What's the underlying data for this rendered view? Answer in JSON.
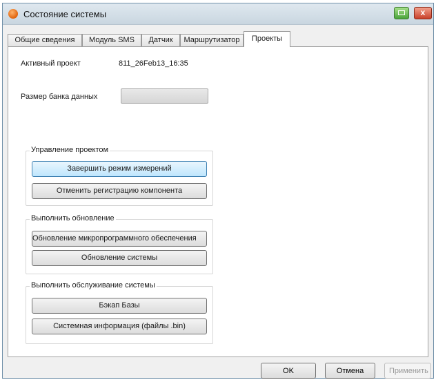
{
  "window": {
    "title": "Состояние системы",
    "app_icon": "testo-logo-icon",
    "controls": {
      "green_icon": "monitor-icon",
      "close_icon": "close-icon",
      "close_glyph": "x"
    }
  },
  "tabs": [
    {
      "label": "Общие сведения",
      "active": false
    },
    {
      "label": "Модуль SMS",
      "active": false
    },
    {
      "label": "Датчик",
      "active": false
    },
    {
      "label": "Маршрутизатор",
      "active": false
    },
    {
      "label": "Проекты",
      "active": true
    }
  ],
  "project": {
    "active_label": "Активный проект",
    "active_value": "811_26Feb13_16:35",
    "db_size_label": "Размер банка данных"
  },
  "groups": {
    "project_management": {
      "title": "Управление проектом",
      "buttons": [
        "Завершить режим измерений",
        "Отменить регистрацию компонента"
      ]
    },
    "update": {
      "title": "Выполнить обновление",
      "buttons": [
        "Обновление микропрограммного обеспечения",
        "Обновление системы"
      ]
    },
    "maintenance": {
      "title": "Выполнить обслуживание системы",
      "buttons": [
        "Бэкап Базы",
        "Системная информация (файлы .bin)"
      ]
    }
  },
  "footer": {
    "ok": "OK",
    "cancel": "Отмена",
    "apply": "Применить"
  },
  "colors": {
    "focused_button": "#bee6fd",
    "window_border": "#6f8fa8"
  }
}
